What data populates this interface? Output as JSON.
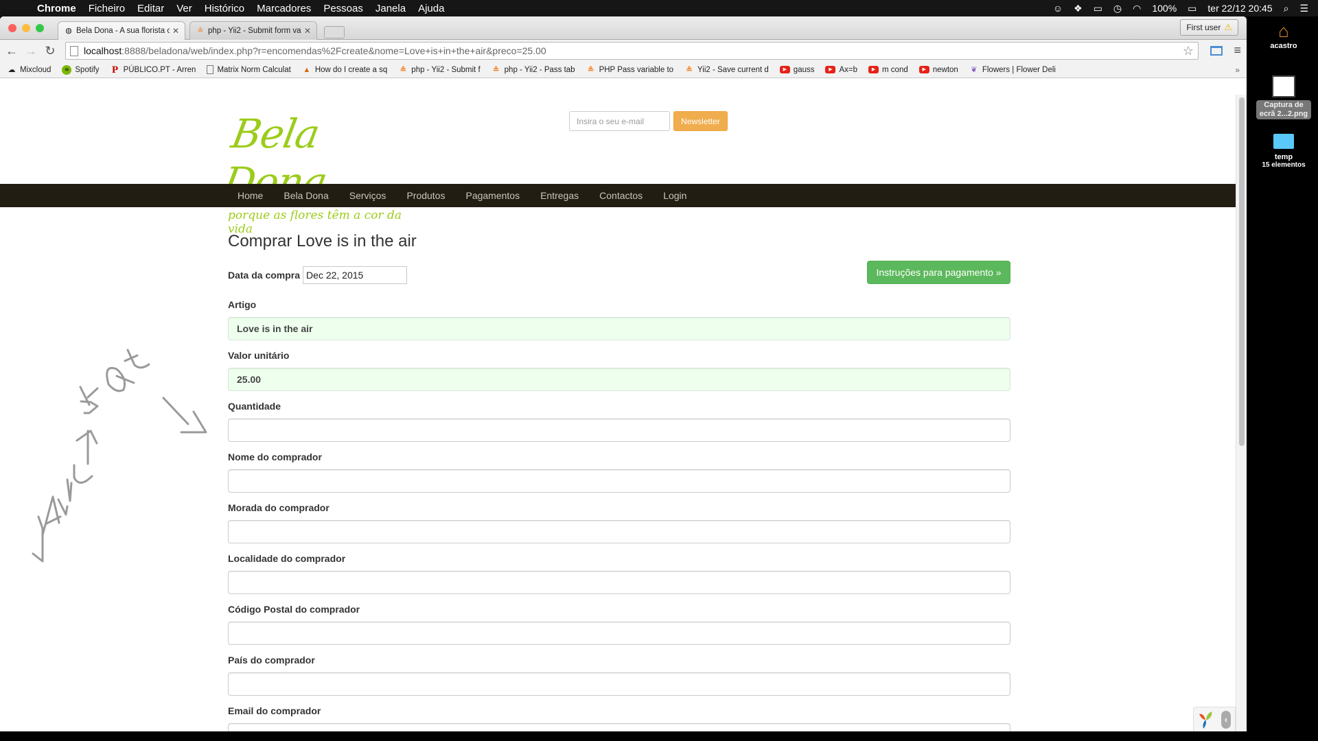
{
  "menubar": {
    "app": "Chrome",
    "items": [
      "Ficheiro",
      "Editar",
      "Ver",
      "Histórico",
      "Marcadores",
      "Pessoas",
      "Janela",
      "Ajuda"
    ],
    "battery": "100%",
    "datetime": "ter 22/12  20:45"
  },
  "browser": {
    "tabs": [
      {
        "title": "Bela Dona - A sua florista c",
        "active": true
      },
      {
        "title": "php - Yii2 - Submit form va",
        "active": false
      }
    ],
    "profile_button": "First user",
    "url_host": "localhost",
    "url_rest": ":8888/beladona/web/index.php?r=encomendas%2Fcreate&nome=Love+is+in+the+air&preco=25.00",
    "bookmarks": [
      {
        "label": "Mixcloud",
        "icon": "cloud-icon"
      },
      {
        "label": "Spotify",
        "icon": "spotify-icon"
      },
      {
        "label": "PÚBLICO.PT - Arren",
        "icon": "publico-icon"
      },
      {
        "label": "Matrix Norm Calculat",
        "icon": "document-icon"
      },
      {
        "label": "How do I create a sq",
        "icon": "matlab-icon"
      },
      {
        "label": "php - Yii2 - Submit f",
        "icon": "stackoverflow-icon"
      },
      {
        "label": "php - Yii2 - Pass tab",
        "icon": "stackoverflow-icon"
      },
      {
        "label": "PHP Pass variable to",
        "icon": "stackoverflow-icon"
      },
      {
        "label": "Yii2 - Save current d",
        "icon": "stackoverflow-icon"
      },
      {
        "label": "gauss",
        "icon": "youtube-icon"
      },
      {
        "label": "Ax=b",
        "icon": "youtube-icon"
      },
      {
        "label": "m cond",
        "icon": "youtube-icon"
      },
      {
        "label": "newton",
        "icon": "youtube-icon"
      },
      {
        "label": "Flowers | Flower Deli",
        "icon": "flower-icon"
      }
    ],
    "bookmarks_more": "»"
  },
  "site": {
    "logo_name": "Bela Dona",
    "logo_slogan": "porque as flores têm a cor da vida",
    "newsletter_placeholder": "Insira o seu e-mail",
    "newsletter_button": "Newsletter",
    "nav": [
      "Home",
      "Bela Dona",
      "Serviços",
      "Produtos",
      "Pagamentos",
      "Entregas",
      "Contactos",
      "Login"
    ]
  },
  "form": {
    "title": "Comprar Love is in the air",
    "date_label": "Data da compra",
    "date_value": "Dec 22, 2015",
    "pay_button": "Instruções para pagamento »",
    "fields": [
      {
        "label": "Artigo",
        "value": "Love is in the air"
      },
      {
        "label": "Valor unitário",
        "value": "25.00"
      },
      {
        "label": "Quantidade",
        "value": ""
      },
      {
        "label": "Nome do comprador",
        "value": ""
      },
      {
        "label": "Morada do comprador",
        "value": ""
      },
      {
        "label": "Localidade do comprador",
        "value": ""
      },
      {
        "label": "Código Postal do comprador",
        "value": ""
      },
      {
        "label": "País do comprador",
        "value": ""
      },
      {
        "label": "Email do comprador",
        "value": ""
      }
    ]
  },
  "annotation": {
    "text": "VALUE → 5 × Qt"
  },
  "desktop": {
    "icons": [
      {
        "label": "acastro",
        "sub": ""
      },
      {
        "label": "Captura de ecrã 2...2.png",
        "sub": ""
      },
      {
        "label": "temp",
        "sub": "15 elementos"
      }
    ]
  },
  "colors": {
    "nav_bg": "#221d12",
    "logo_green": "#9ccc1b",
    "newsletter_orange": "#f0ad4e",
    "pay_green": "#5cb85c",
    "filled_field_bg": "#eeffee"
  }
}
